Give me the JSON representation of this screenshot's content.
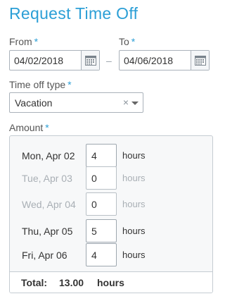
{
  "page": {
    "title": "Request Time Off"
  },
  "from": {
    "label": "From",
    "required_mark": "*",
    "value": "04/02/2018"
  },
  "separator": "–",
  "to": {
    "label": "To",
    "required_mark": "*",
    "value": "04/06/2018"
  },
  "timeoff_type": {
    "label": "Time off type",
    "required_mark": "*",
    "value": "Vacation",
    "clear_glyph": "×"
  },
  "amount": {
    "label": "Amount",
    "required_mark": "*",
    "rows": [
      {
        "day": "Mon, Apr 02",
        "value": "4",
        "unit": "hours",
        "disabled": false
      },
      {
        "day": "Tue, Apr 03",
        "value": "0",
        "unit": "hours",
        "disabled": true
      },
      {
        "day": "Wed, Apr 04",
        "value": "0",
        "unit": "hours",
        "disabled": true
      },
      {
        "day": "Thu, Apr 05",
        "value": "5",
        "unit": "hours",
        "disabled": false
      },
      {
        "day": "Fri, Apr 06",
        "value": "4",
        "unit": "hours",
        "disabled": false
      }
    ],
    "total": {
      "label": "Total:",
      "value": "13.00",
      "unit": "hours"
    }
  },
  "icons": {
    "calendar": "calendar-icon",
    "dropdown": "chevron-down-icon"
  },
  "colors": {
    "accent": "#2c9fd6",
    "disabled_text": "#a9afb5",
    "panel_bg": "#f7f8f9"
  }
}
